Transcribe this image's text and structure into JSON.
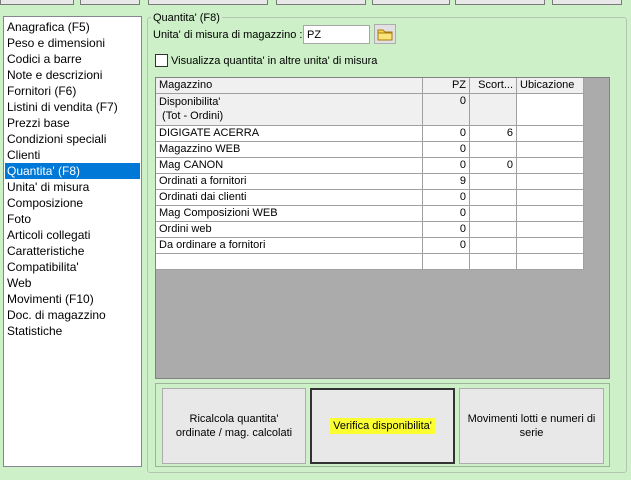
{
  "sidebar": {
    "items": [
      {
        "label": "Anagrafica (F5)",
        "selected": false
      },
      {
        "label": "Peso e dimensioni",
        "selected": false
      },
      {
        "label": "Codici a barre",
        "selected": false
      },
      {
        "label": "Note e descrizioni",
        "selected": false
      },
      {
        "label": "Fornitori (F6)",
        "selected": false
      },
      {
        "label": "Listini di vendita (F7)",
        "selected": false
      },
      {
        "label": "Prezzi base",
        "selected": false
      },
      {
        "label": "Condizioni speciali",
        "selected": false
      },
      {
        "label": "Clienti",
        "selected": false
      },
      {
        "label": "Quantita' (F8)",
        "selected": true
      },
      {
        "label": "Unita' di misura",
        "selected": false
      },
      {
        "label": "Composizione",
        "selected": false
      },
      {
        "label": "Foto",
        "selected": false
      },
      {
        "label": "Articoli collegati",
        "selected": false
      },
      {
        "label": "Caratteristiche",
        "selected": false
      },
      {
        "label": "Compatibilita'",
        "selected": false
      },
      {
        "label": "Web",
        "selected": false
      },
      {
        "label": "Movimenti (F10)",
        "selected": false
      },
      {
        "label": "Doc. di magazzino",
        "selected": false
      },
      {
        "label": "Statistiche",
        "selected": false
      }
    ]
  },
  "group": {
    "title": "Quantita' (F8)",
    "um_label": "Unita' di misura di magazzino :",
    "um_value": "PZ",
    "folder_icon": "folder-icon",
    "checkbox_label": "Visualizza quantita' in altre unita' di misura",
    "checkbox_checked": false
  },
  "grid": {
    "headers": [
      "Magazzino",
      "PZ",
      "Scort...",
      "Ubicazione"
    ],
    "rows": [
      {
        "magazzino": "Disponibilita'\n (Tot - Ordini)",
        "pz": "0",
        "scorta": "",
        "ubicazione": "",
        "gray": true
      },
      {
        "magazzino": "DIGIGATE ACERRA",
        "pz": "0",
        "scorta": "6",
        "ubicazione": "",
        "gray": false
      },
      {
        "magazzino": "Magazzino WEB",
        "pz": "0",
        "scorta": "",
        "ubicazione": "",
        "gray": false
      },
      {
        "magazzino": "Mag CANON",
        "pz": "0",
        "scorta": "0",
        "ubicazione": "",
        "gray": false
      },
      {
        "magazzino": "Ordinati a fornitori",
        "pz": "9",
        "scorta": "",
        "ubicazione": "",
        "gray": false
      },
      {
        "magazzino": "Ordinati dai clienti",
        "pz": "0",
        "scorta": "",
        "ubicazione": "",
        "gray": false
      },
      {
        "magazzino": "Mag Composizioni WEB",
        "pz": "0",
        "scorta": "",
        "ubicazione": "",
        "gray": false
      },
      {
        "magazzino": "Ordini web",
        "pz": "0",
        "scorta": "",
        "ubicazione": "",
        "gray": false
      },
      {
        "magazzino": "Da ordinare a fornitori",
        "pz": "0",
        "scorta": "",
        "ubicazione": "",
        "gray": false
      },
      {
        "magazzino": "",
        "pz": "",
        "scorta": "",
        "ubicazione": "",
        "gray": false
      }
    ]
  },
  "buttons": {
    "ricalcola": "Ricalcola quantita' ordinate / mag. calcolati",
    "verifica": "Verifica disponibilita'",
    "movimenti": "Movimenti lotti e numeri di serie",
    "highlight_color": "#fbff32"
  },
  "colors": {
    "background": "#cdf0c8",
    "selection": "#0078d7"
  }
}
